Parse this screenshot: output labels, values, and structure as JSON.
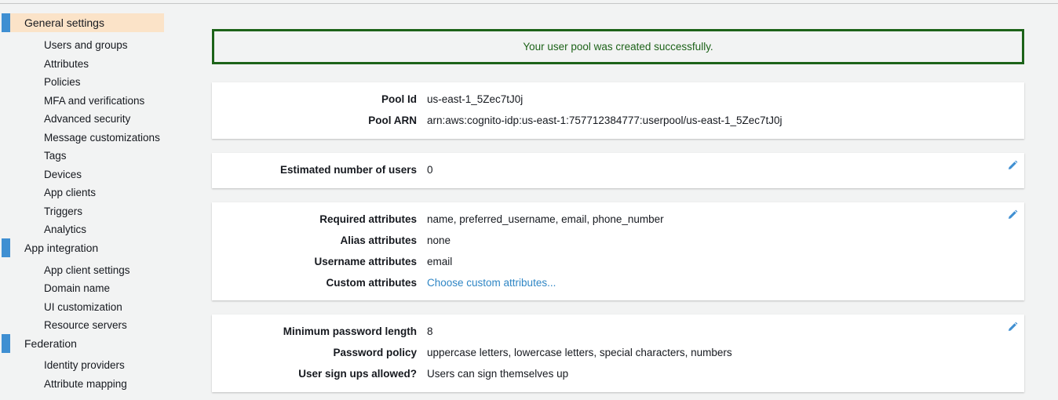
{
  "sidebar": {
    "sections": [
      {
        "label": "General settings",
        "active": true
      },
      {
        "label": "App integration",
        "active": false
      },
      {
        "label": "Federation",
        "active": false
      }
    ],
    "general_items": [
      "Users and groups",
      "Attributes",
      "Policies",
      "MFA and verifications",
      "Advanced security",
      "Message customizations",
      "Tags",
      "Devices",
      "App clients",
      "Triggers",
      "Analytics"
    ],
    "app_items": [
      "App client settings",
      "Domain name",
      "UI customization",
      "Resource servers"
    ],
    "federation_items": [
      "Identity providers",
      "Attribute mapping"
    ]
  },
  "banner": {
    "message": "Your user pool was created successfully."
  },
  "pool": {
    "id_label": "Pool Id",
    "id_value": "us-east-1_5Zec7tJ0j",
    "arn_label": "Pool ARN",
    "arn_value": "arn:aws:cognito-idp:us-east-1:757712384777:userpool/us-east-1_5Zec7tJ0j"
  },
  "users": {
    "label": "Estimated number of users",
    "value": "0"
  },
  "attributes": {
    "required_label": "Required attributes",
    "required_value": "name, preferred_username, email, phone_number",
    "alias_label": "Alias attributes",
    "alias_value": "none",
    "username_label": "Username attributes",
    "username_value": "email",
    "custom_label": "Custom attributes",
    "custom_link": "Choose custom attributes..."
  },
  "password": {
    "min_label": "Minimum password length",
    "min_value": "8",
    "policy_label": "Password policy",
    "policy_value": "uppercase letters, lowercase letters, special characters, numbers",
    "signup_label": "User sign ups allowed?",
    "signup_value": "Users can sign themselves up"
  },
  "colors": {
    "accent": "#3f8fd2",
    "active_bg": "#fbe3c8",
    "success": "#1d6319",
    "link": "#2f86c5"
  },
  "icons": {
    "edit": "pencil-icon"
  }
}
